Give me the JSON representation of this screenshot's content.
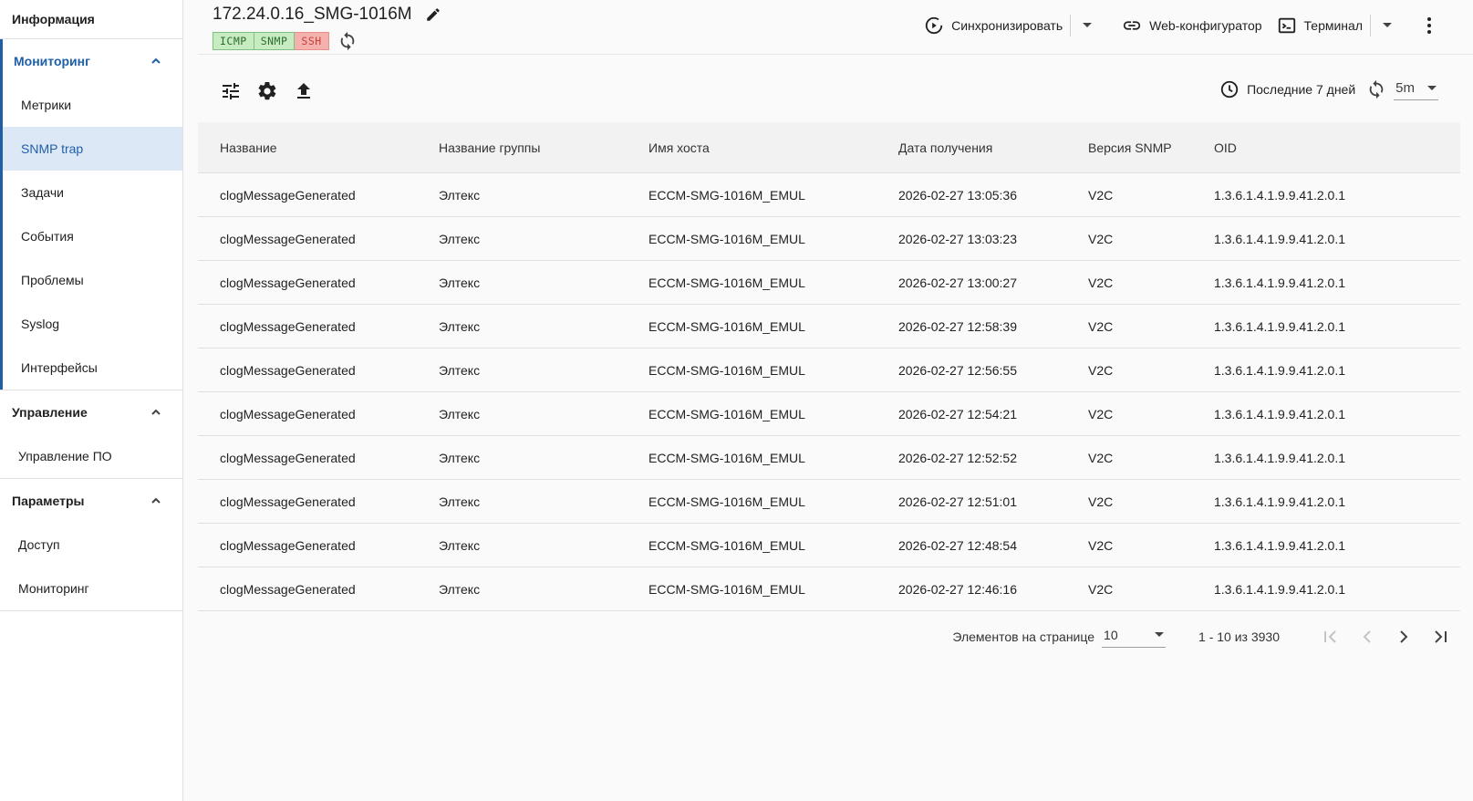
{
  "sidebar": {
    "info": "Информация",
    "monitoring": {
      "title": "Мониторинг",
      "items": [
        "Метрики",
        "SNMP trap",
        "Задачи",
        "События",
        "Проблемы",
        "Syslog",
        "Интерфейсы"
      ],
      "active": "SNMP trap"
    },
    "management": {
      "title": "Управление",
      "items": [
        "Управление ПО"
      ]
    },
    "parameters": {
      "title": "Параметры",
      "items": [
        "Доступ",
        "Мониторинг"
      ]
    }
  },
  "header": {
    "title": "172.24.0.16_SMG-1016M",
    "badges": [
      {
        "label": "ICMP",
        "status": "ok"
      },
      {
        "label": "SNMP",
        "status": "ok"
      },
      {
        "label": "SSH",
        "status": "error"
      }
    ],
    "actions": {
      "sync": "Синхронизировать",
      "web": "Web-конфигуратор",
      "terminal": "Терминал"
    }
  },
  "toolbar": {
    "period": "Последние 7 дней",
    "interval": "5m"
  },
  "table": {
    "columns": [
      "Название",
      "Название группы",
      "Имя хоста",
      "Дата получения",
      "Версия SNMP",
      "OID"
    ],
    "rows": [
      [
        "clogMessageGenerated",
        "Элтекс",
        "ECCM-SMG-1016M_EMUL",
        "2026-02-27 13:05:36",
        "V2C",
        "1.3.6.1.4.1.9.9.41.2.0.1"
      ],
      [
        "clogMessageGenerated",
        "Элтекс",
        "ECCM-SMG-1016M_EMUL",
        "2026-02-27 13:03:23",
        "V2C",
        "1.3.6.1.4.1.9.9.41.2.0.1"
      ],
      [
        "clogMessageGenerated",
        "Элтекс",
        "ECCM-SMG-1016M_EMUL",
        "2026-02-27 13:00:27",
        "V2C",
        "1.3.6.1.4.1.9.9.41.2.0.1"
      ],
      [
        "clogMessageGenerated",
        "Элтекс",
        "ECCM-SMG-1016M_EMUL",
        "2026-02-27 12:58:39",
        "V2C",
        "1.3.6.1.4.1.9.9.41.2.0.1"
      ],
      [
        "clogMessageGenerated",
        "Элтекс",
        "ECCM-SMG-1016M_EMUL",
        "2026-02-27 12:56:55",
        "V2C",
        "1.3.6.1.4.1.9.9.41.2.0.1"
      ],
      [
        "clogMessageGenerated",
        "Элтекс",
        "ECCM-SMG-1016M_EMUL",
        "2026-02-27 12:54:21",
        "V2C",
        "1.3.6.1.4.1.9.9.41.2.0.1"
      ],
      [
        "clogMessageGenerated",
        "Элтекс",
        "ECCM-SMG-1016M_EMUL",
        "2026-02-27 12:52:52",
        "V2C",
        "1.3.6.1.4.1.9.9.41.2.0.1"
      ],
      [
        "clogMessageGenerated",
        "Элтекс",
        "ECCM-SMG-1016M_EMUL",
        "2026-02-27 12:51:01",
        "V2C",
        "1.3.6.1.4.1.9.9.41.2.0.1"
      ],
      [
        "clogMessageGenerated",
        "Элтекс",
        "ECCM-SMG-1016M_EMUL",
        "2026-02-27 12:48:54",
        "V2C",
        "1.3.6.1.4.1.9.9.41.2.0.1"
      ],
      [
        "clogMessageGenerated",
        "Элтекс",
        "ECCM-SMG-1016M_EMUL",
        "2026-02-27 12:46:16",
        "V2C",
        "1.3.6.1.4.1.9.9.41.2.0.1"
      ]
    ]
  },
  "paginator": {
    "label": "Элементов на странице",
    "page_size": "10",
    "range": "1 - 10 из 3930"
  },
  "colors": {
    "accent": "#1e5fa8",
    "active_bg": "#dde8f6",
    "badge_ok": "#c8ecc2",
    "badge_error": "#f4b1ad"
  }
}
